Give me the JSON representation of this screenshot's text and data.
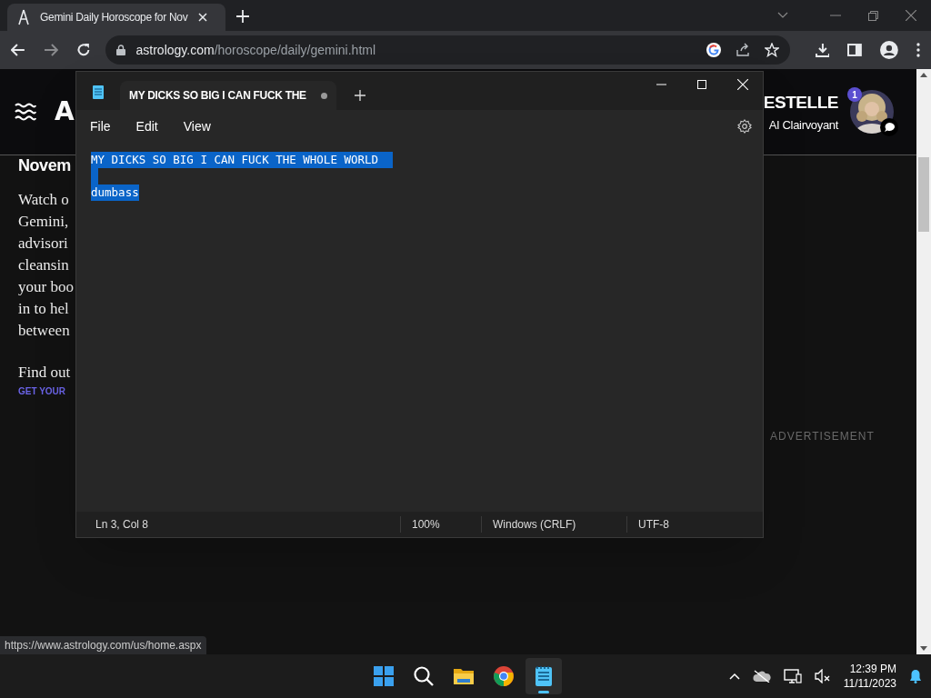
{
  "browser": {
    "tabs": [
      {
        "title": "Gemini Daily Horoscope for Nov",
        "selected": true
      }
    ],
    "address": {
      "host": "astrology.com",
      "path": "/horoscope/daily/gemini.html"
    },
    "status_url": "https://www.astrology.com/us/home.aspx"
  },
  "page": {
    "logo": "A",
    "advisor": {
      "name": "ESTELLE",
      "role": "AI Clairvoyant",
      "badge": "1"
    },
    "heading": "Novem",
    "lines": [
      "Watch o",
      "Gemini,",
      "advisori",
      "cleansin",
      "your boo",
      "in to hel",
      "between"
    ],
    "find": "Find out",
    "cta": "GET YOUR",
    "ad_label": "ADVERTISEMENT"
  },
  "notepad": {
    "tabs": [
      {
        "title": "MY DICKS SO BIG I CAN FUCK THE",
        "modified": true,
        "selected": true
      }
    ],
    "menu": [
      "File",
      "Edit",
      "View"
    ],
    "lines": [
      {
        "text": "MY DICKS SO BIG I CAN FUCK THE WHOLE WORLD",
        "selected": true
      },
      {
        "selected": true
      },
      {
        "text": "dumbass",
        "selected": true
      }
    ],
    "status": [
      "Ln 3, Col 8",
      "100%",
      "Windows (CRLF)",
      "UTF-8"
    ]
  },
  "taskbar": {
    "apps": [
      {
        "kind": "start",
        "active": false
      },
      {
        "kind": "search",
        "active": false
      },
      {
        "kind": "files",
        "active": false
      },
      {
        "kind": "chrome",
        "active": false
      },
      {
        "kind": "notepad",
        "active": true
      }
    ],
    "time": "12:39 PM",
    "date": "11/11/2023"
  }
}
